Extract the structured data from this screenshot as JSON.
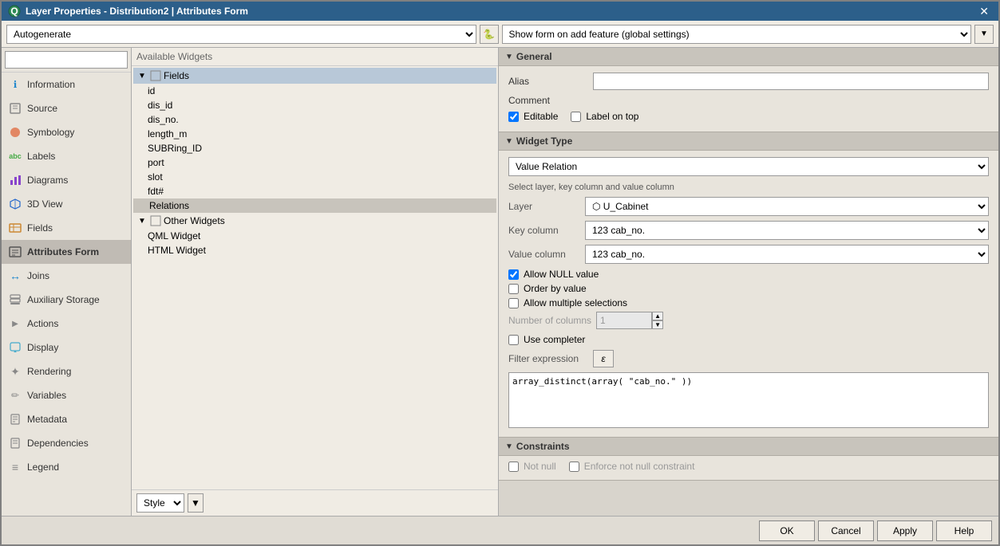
{
  "window": {
    "title": "Layer Properties - Distribution2 | Attributes Form",
    "close_label": "✕"
  },
  "toolbar": {
    "autogenerate_label": "Autogenerate",
    "python_icon": "🐍",
    "show_form_label": "Show form on add feature (global settings)",
    "show_form_arrow": "▼",
    "autogenerate_arrow": "▼"
  },
  "sidebar": {
    "search_placeholder": "",
    "items": [
      {
        "id": "information",
        "label": "Information",
        "icon": "ℹ",
        "color": "#2288cc"
      },
      {
        "id": "source",
        "label": "Source",
        "icon": "⚙",
        "color": "#888"
      },
      {
        "id": "symbology",
        "label": "Symbology",
        "icon": "🎨",
        "color": "#e06030"
      },
      {
        "id": "labels",
        "label": "Labels",
        "icon": "abc",
        "color": "#44aa44"
      },
      {
        "id": "diagrams",
        "label": "Diagrams",
        "icon": "📊",
        "color": "#8844cc"
      },
      {
        "id": "3dview",
        "label": "3D View",
        "icon": "🧊",
        "color": "#2266cc"
      },
      {
        "id": "fields",
        "label": "Fields",
        "icon": "⊞",
        "color": "#cc8833"
      },
      {
        "id": "attributes-form",
        "label": "Attributes Form",
        "icon": "📋",
        "color": "#555"
      },
      {
        "id": "joins",
        "label": "Joins",
        "icon": "↔",
        "color": "#2288cc"
      },
      {
        "id": "auxiliary-storage",
        "label": "Auxiliary Storage",
        "icon": "🗄",
        "color": "#888"
      },
      {
        "id": "actions",
        "label": "Actions",
        "icon": "▶",
        "color": "#888"
      },
      {
        "id": "display",
        "label": "Display",
        "icon": "💬",
        "color": "#44aacc"
      },
      {
        "id": "rendering",
        "label": "Rendering",
        "icon": "✦",
        "color": "#888"
      },
      {
        "id": "variables",
        "label": "Variables",
        "icon": "✏",
        "color": "#888"
      },
      {
        "id": "metadata",
        "label": "Metadata",
        "icon": "📄",
        "color": "#888"
      },
      {
        "id": "dependencies",
        "label": "Dependencies",
        "icon": "📝",
        "color": "#888"
      },
      {
        "id": "legend",
        "label": "Legend",
        "icon": "≡",
        "color": "#888"
      }
    ]
  },
  "center_panel": {
    "header": "Available Widgets",
    "tree": {
      "fields_label": "Fields",
      "fields_arrow": "▼",
      "fields_icon": "▼",
      "field_items": [
        "id",
        "dis_id",
        "dis_no.",
        "length_m",
        "SUBRing_ID",
        "port",
        "slot",
        "fdt#"
      ],
      "relations_label": "Relations",
      "other_widgets_label": "Other Widgets",
      "other_items": [
        "QML Widget",
        "HTML Widget"
      ]
    },
    "footer": {
      "style_label": "Style",
      "style_arrow": "▼"
    }
  },
  "right_panel": {
    "general_section": {
      "title": "General",
      "alias_label": "Alias",
      "alias_value": "",
      "comment_label": "Comment",
      "editable_label": "Editable",
      "editable_checked": true,
      "label_on_top_label": "Label on top",
      "label_on_top_checked": false
    },
    "widget_type_section": {
      "title": "Widget Type",
      "selected_type": "Value Relation",
      "sub_label": "Select layer, key column and value column",
      "layer_label": "Layer",
      "layer_icon": "⬡",
      "layer_value": "U_Cabinet",
      "key_column_label": "Key column",
      "key_column_icon": "123",
      "key_column_value": "cab_no.",
      "value_column_label": "Value column",
      "value_column_icon": "123",
      "value_column_value": "cab_no.",
      "allow_null_label": "Allow NULL value",
      "allow_null_checked": true,
      "order_by_value_label": "Order by value",
      "order_by_value_checked": false,
      "allow_multiple_label": "Allow multiple selections",
      "allow_multiple_checked": false,
      "num_columns_label": "Number of columns",
      "num_columns_value": "1",
      "use_completer_label": "Use completer",
      "use_completer_checked": false,
      "filter_expression_label": "Filter expression",
      "filter_btn_label": "ε",
      "expression_value": "array_distinct(array( \"cab_no.\" ))"
    },
    "constraints_section": {
      "title": "Constraints",
      "not_null_label": "Not null",
      "not_null_checked": false,
      "enforce_not_null_label": "Enforce not null constraint"
    }
  },
  "bottom_bar": {
    "ok_label": "OK",
    "cancel_label": "Cancel",
    "apply_label": "Apply",
    "help_label": "Help"
  }
}
